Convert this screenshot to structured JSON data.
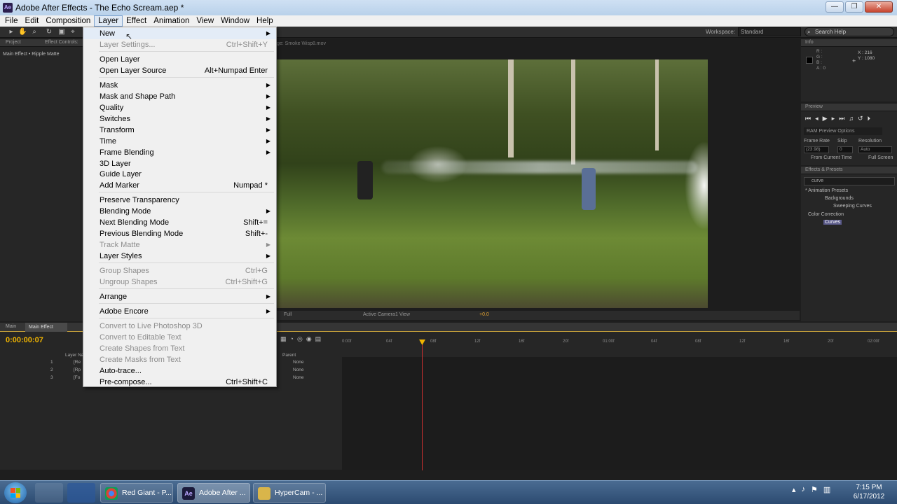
{
  "window": {
    "title": "Adobe After Effects - The Echo Scream.aep *",
    "app_icon": "Ae"
  },
  "menubar": [
    "File",
    "Edit",
    "Composition",
    "Layer",
    "Effect",
    "Animation",
    "View",
    "Window",
    "Help"
  ],
  "toolbar": {
    "workspace_label": "Workspace:",
    "workspace_value": "Standard",
    "search_placeholder": "Search Help"
  },
  "left_panel": {
    "tab_project": "Project",
    "tab_effect_controls": "Effect Controls:",
    "subtitle": "Main Effect • Ripple Matte"
  },
  "viewer": {
    "tab_path": "ge: Smoke Wisp8.mov",
    "footer_res": "Full",
    "footer_camera": "Active Camera",
    "footer_view": "1 View",
    "footer_exposure": "+0.0"
  },
  "info": {
    "title": "Info",
    "rgba": [
      "R :",
      "G :",
      "B :",
      "A : 0"
    ],
    "x": "X : 216",
    "y": "Y : 1080"
  },
  "preview": {
    "title": "Preview",
    "ram_options": "RAM Preview Options",
    "frame_rate_label": "Frame Rate",
    "skip_label": "Skip",
    "resolution_label": "Resolution",
    "frame_rate_value": "(23.98)",
    "skip_value": "0",
    "resolution_value": "Auto",
    "from_current": "From Current Time",
    "full_screen": "Full Screen"
  },
  "effects": {
    "title": "Effects & Presets",
    "search_value": "curve",
    "tree": [
      "* Animation Presets",
      "Backgrounds",
      "Sweeping Curves",
      "Color Correction",
      "Curves"
    ]
  },
  "timeline": {
    "tabs": [
      "Main",
      "Main Effect"
    ],
    "timecode": "0:00:00:07",
    "column_layer_name": "Layer Na",
    "column_parent": "Parent",
    "layers": [
      {
        "num": "1",
        "name": "[Re",
        "parent": "None"
      },
      {
        "num": "2",
        "name": "[Rp",
        "parent": "None"
      },
      {
        "num": "3",
        "name": "[Fo",
        "parent": "None"
      }
    ],
    "ruler": [
      "0:00f",
      "04f",
      "08f",
      "12f",
      "16f",
      "20f",
      "01:00f",
      "04f",
      "08f",
      "12f",
      "16f",
      "20f",
      "02:00f"
    ]
  },
  "layer_menu": {
    "items": [
      {
        "label": "New",
        "shortcut": "",
        "submenu": true,
        "disabled": false,
        "hover": true
      },
      {
        "label": "Layer Settings...",
        "shortcut": "Ctrl+Shift+Y",
        "submenu": false,
        "disabled": true
      },
      {
        "label": "Open Layer",
        "shortcut": "",
        "submenu": false,
        "disabled": false
      },
      {
        "label": "Open Layer Source",
        "shortcut": "Alt+Numpad Enter",
        "submenu": false,
        "disabled": false
      },
      {
        "label": "Mask",
        "shortcut": "",
        "submenu": true,
        "disabled": false
      },
      {
        "label": "Mask and Shape Path",
        "shortcut": "",
        "submenu": true,
        "disabled": false
      },
      {
        "label": "Quality",
        "shortcut": "",
        "submenu": true,
        "disabled": false
      },
      {
        "label": "Switches",
        "shortcut": "",
        "submenu": true,
        "disabled": false
      },
      {
        "label": "Transform",
        "shortcut": "",
        "submenu": true,
        "disabled": false
      },
      {
        "label": "Time",
        "shortcut": "",
        "submenu": true,
        "disabled": false
      },
      {
        "label": "Frame Blending",
        "shortcut": "",
        "submenu": true,
        "disabled": false
      },
      {
        "label": "3D Layer",
        "shortcut": "",
        "submenu": false,
        "disabled": false
      },
      {
        "label": "Guide Layer",
        "shortcut": "",
        "submenu": false,
        "disabled": false
      },
      {
        "label": "Add Marker",
        "shortcut": "Numpad *",
        "submenu": false,
        "disabled": false
      },
      {
        "label": "Preserve Transparency",
        "shortcut": "",
        "submenu": false,
        "disabled": false
      },
      {
        "label": "Blending Mode",
        "shortcut": "",
        "submenu": true,
        "disabled": false
      },
      {
        "label": "Next Blending Mode",
        "shortcut": "Shift+=",
        "submenu": false,
        "disabled": false
      },
      {
        "label": "Previous Blending Mode",
        "shortcut": "Shift+-",
        "submenu": false,
        "disabled": false
      },
      {
        "label": "Track Matte",
        "shortcut": "",
        "submenu": true,
        "disabled": true
      },
      {
        "label": "Layer Styles",
        "shortcut": "",
        "submenu": true,
        "disabled": false
      },
      {
        "label": "Group Shapes",
        "shortcut": "Ctrl+G",
        "submenu": false,
        "disabled": true
      },
      {
        "label": "Ungroup Shapes",
        "shortcut": "Ctrl+Shift+G",
        "submenu": false,
        "disabled": true
      },
      {
        "label": "Arrange",
        "shortcut": "",
        "submenu": true,
        "disabled": false
      },
      {
        "label": "Adobe Encore",
        "shortcut": "",
        "submenu": true,
        "disabled": false
      },
      {
        "label": "Convert to Live Photoshop 3D",
        "shortcut": "",
        "submenu": false,
        "disabled": true
      },
      {
        "label": "Convert to Editable Text",
        "shortcut": "",
        "submenu": false,
        "disabled": true
      },
      {
        "label": "Create Shapes from Text",
        "shortcut": "",
        "submenu": false,
        "disabled": true
      },
      {
        "label": "Create Masks from Text",
        "shortcut": "",
        "submenu": false,
        "disabled": true
      },
      {
        "label": "Auto-trace...",
        "shortcut": "",
        "submenu": false,
        "disabled": false
      },
      {
        "label": "Pre-compose...",
        "shortcut": "Ctrl+Shift+C",
        "submenu": false,
        "disabled": false
      }
    ]
  },
  "taskbar": {
    "buttons": [
      {
        "label": "Red Giant - P...",
        "icon": "chrome-icon"
      },
      {
        "label": "Adobe After ...",
        "icon": "after-effects-icon",
        "active": true
      },
      {
        "label": "HyperCam - ...",
        "icon": "hypercam-icon"
      }
    ],
    "time": "7:15 PM",
    "date": "6/17/2012"
  },
  "colors": {
    "timecode": "#f0b400",
    "playhead": "#d03030",
    "menu_bg": "#f0f0f0"
  }
}
